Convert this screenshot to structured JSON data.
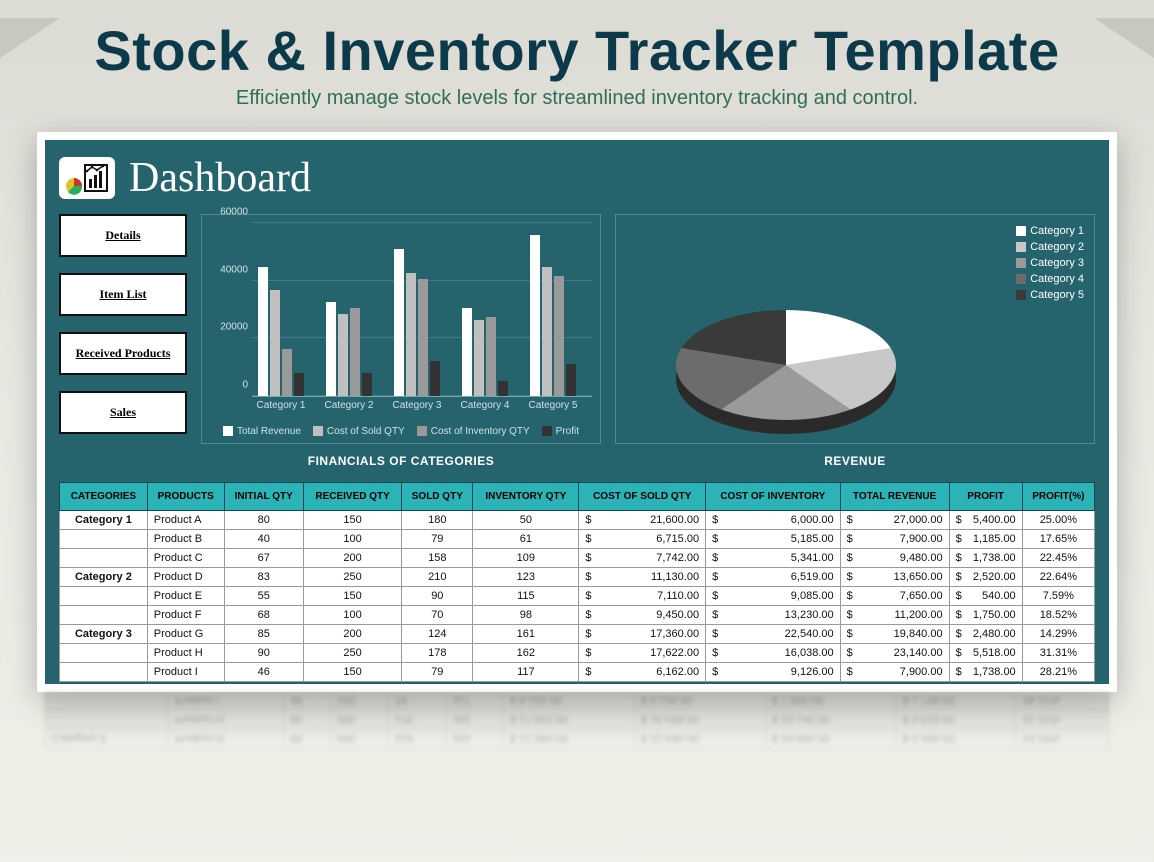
{
  "page": {
    "title": "Stock & Inventory Tracker Template",
    "subtitle": "Efficiently manage stock levels for streamlined inventory tracking and control."
  },
  "dashboard": {
    "title": "Dashboard",
    "sidebar": [
      "Details",
      "Item List",
      "Received Products",
      "Sales"
    ],
    "bar_caption": "FINANCIALS OF CATEGORIES",
    "pie_caption": "REVENUE",
    "bar_legend": [
      "Total Revenue",
      "Cost of Sold QTY",
      "Cost of Inventory QTY",
      "Profit"
    ],
    "pie_legend": [
      "Category 1",
      "Category 2",
      "Category 3",
      "Category 4",
      "Category 5"
    ]
  },
  "table": {
    "headers": [
      "CATEGORIES",
      "PRODUCTS",
      "INITIAL QTY",
      "RECEIVED QTY",
      "SOLD QTY",
      "INVENTORY QTY",
      "COST OF SOLD QTY",
      "COST OF INVENTORY",
      "TOTAL REVENUE",
      "PROFIT",
      "PROFIT(%)"
    ],
    "rows": [
      {
        "cat": "Category 1",
        "prod": "Product A",
        "iq": "80",
        "rq": "150",
        "sq": "180",
        "inq": "50",
        "csq": "21,600.00",
        "cinv": "6,000.00",
        "rev": "27,000.00",
        "prof": "5,400.00",
        "pct": "25.00%"
      },
      {
        "cat": "",
        "prod": "Product B",
        "iq": "40",
        "rq": "100",
        "sq": "79",
        "inq": "61",
        "csq": "6,715.00",
        "cinv": "5,185.00",
        "rev": "7,900.00",
        "prof": "1,185.00",
        "pct": "17.65%"
      },
      {
        "cat": "",
        "prod": "Product C",
        "iq": "67",
        "rq": "200",
        "sq": "158",
        "inq": "109",
        "csq": "7,742.00",
        "cinv": "5,341.00",
        "rev": "9,480.00",
        "prof": "1,738.00",
        "pct": "22.45%"
      },
      {
        "cat": "Category 2",
        "prod": "Product D",
        "iq": "83",
        "rq": "250",
        "sq": "210",
        "inq": "123",
        "csq": "11,130.00",
        "cinv": "6,519.00",
        "rev": "13,650.00",
        "prof": "2,520.00",
        "pct": "22.64%"
      },
      {
        "cat": "",
        "prod": "Product E",
        "iq": "55",
        "rq": "150",
        "sq": "90",
        "inq": "115",
        "csq": "7,110.00",
        "cinv": "9,085.00",
        "rev": "7,650.00",
        "prof": "540.00",
        "pct": "7.59%"
      },
      {
        "cat": "",
        "prod": "Product F",
        "iq": "68",
        "rq": "100",
        "sq": "70",
        "inq": "98",
        "csq": "9,450.00",
        "cinv": "13,230.00",
        "rev": "11,200.00",
        "prof": "1,750.00",
        "pct": "18.52%"
      },
      {
        "cat": "Category 3",
        "prod": "Product G",
        "iq": "85",
        "rq": "200",
        "sq": "124",
        "inq": "161",
        "csq": "17,360.00",
        "cinv": "22,540.00",
        "rev": "19,840.00",
        "prof": "2,480.00",
        "pct": "14.29%"
      },
      {
        "cat": "",
        "prod": "Product H",
        "iq": "90",
        "rq": "250",
        "sq": "178",
        "inq": "162",
        "csq": "17,622.00",
        "cinv": "16,038.00",
        "rev": "23,140.00",
        "prof": "5,518.00",
        "pct": "31.31%"
      },
      {
        "cat": "",
        "prod": "Product I",
        "iq": "46",
        "rq": "150",
        "sq": "79",
        "inq": "117",
        "csq": "6,162.00",
        "cinv": "9,126.00",
        "rev": "7,900.00",
        "prof": "1,738.00",
        "pct": "28.21%"
      }
    ]
  },
  "chart_data": {
    "bar": {
      "type": "bar",
      "title": "Financials of Categories",
      "categories": [
        "Category 1",
        "Category 2",
        "Category 3",
        "Category 4",
        "Category 5"
      ],
      "y_ticks": [
        0,
        20000,
        40000,
        60000
      ],
      "ylim": [
        0,
        60000
      ],
      "series": [
        {
          "name": "Total Revenue",
          "values": [
            44000,
            32000,
            50000,
            30000,
            55000
          ]
        },
        {
          "name": "Cost of Sold QTY",
          "values": [
            36000,
            28000,
            42000,
            26000,
            44000
          ]
        },
        {
          "name": "Cost of Inventory QTY",
          "values": [
            16000,
            30000,
            40000,
            27000,
            41000
          ]
        },
        {
          "name": "Profit",
          "values": [
            8000,
            8000,
            12000,
            5000,
            11000
          ]
        }
      ]
    },
    "pie": {
      "type": "pie",
      "title": "Revenue",
      "labels": [
        "Category 1",
        "Category 2",
        "Category 3",
        "Category 4",
        "Category 5"
      ],
      "values": [
        20,
        20,
        20,
        20,
        20
      ]
    }
  }
}
